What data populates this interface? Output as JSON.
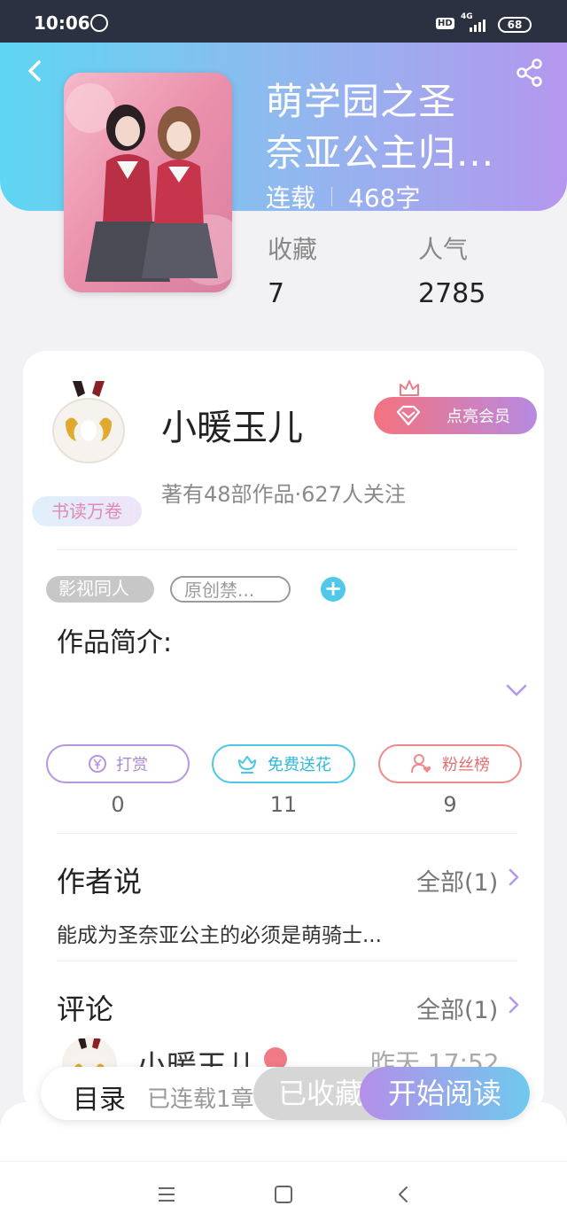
{
  "status_bar": {
    "time": "10:06",
    "hd": "HD",
    "network": "4G",
    "battery": "68"
  },
  "book": {
    "title_line1": "萌学园之圣",
    "title_line2": "奈亚公主归...",
    "status": "连载",
    "word_count": "468字",
    "favorites_label": "收藏",
    "favorites_value": "7",
    "popularity_label": "人气",
    "popularity_value": "2785"
  },
  "author": {
    "name": "小暖玉儿",
    "badge": "书读万卷",
    "vip_label": "点亮会员",
    "meta": "著有48部作品·627人关注"
  },
  "tags": [
    "影视同人",
    "原创禁..."
  ],
  "intro_label": "作品简介:",
  "actions": [
    {
      "label": "打赏",
      "count": "0"
    },
    {
      "label": "免费送花",
      "count": "11"
    },
    {
      "label": "粉丝榜",
      "count": "9"
    }
  ],
  "author_says": {
    "title": "作者说",
    "more": "全部(1)",
    "note": "能成为圣奈亚公主的必须是萌骑士..."
  },
  "comments": {
    "title": "评论",
    "more": "全部(1)",
    "first_name": "小暖玉儿",
    "first_time": "昨天 17:52"
  },
  "bottom_bar": {
    "toc": "目录",
    "toc_meta": "已连载1章",
    "collected": "已收藏",
    "read": "开始阅读"
  },
  "colors": {
    "accent_purple": "#b497ee",
    "accent_cyan": "#5ed6f3",
    "vip_pink": "#f5727e"
  }
}
